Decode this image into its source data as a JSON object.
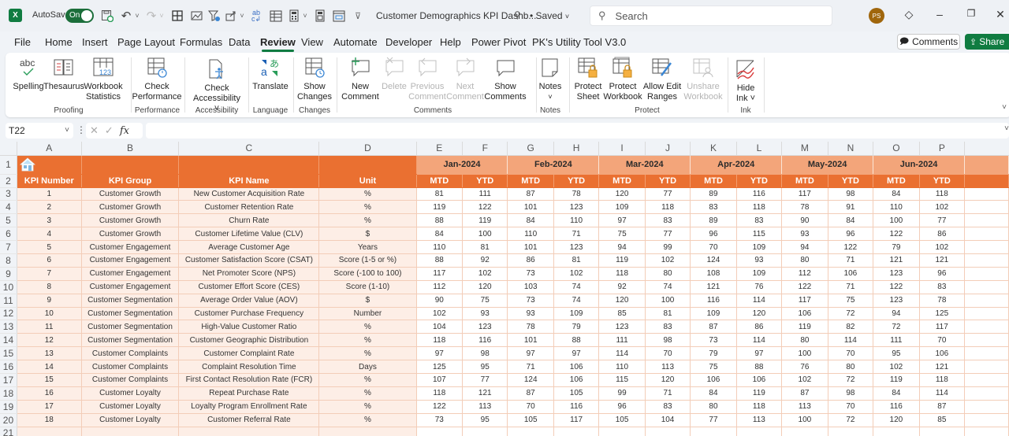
{
  "app": {
    "autosave_label": "AutoSave",
    "autosave_state": "On",
    "doc_title": "Customer Demographics KPI Dashb...",
    "saved_label": "• Saved",
    "search_placeholder": "Search",
    "user_initials": "PS",
    "brand_color": "#107c41"
  },
  "menu": {
    "tabs": [
      "File",
      "Home",
      "Insert",
      "Page Layout",
      "Formulas",
      "Data",
      "Review",
      "View",
      "Automate",
      "Developer",
      "Help",
      "Power Pivot",
      "PK's Utility Tool V3.0"
    ],
    "active": "Review",
    "comments_label": "Comments",
    "share_label": "Share"
  },
  "ribbon": {
    "buttons": {
      "spelling": "Spelling",
      "thesaurus": "Thesaurus",
      "workbook_statistics": [
        "Workbook",
        "Statistics"
      ],
      "check_performance": [
        "Check",
        "Performance"
      ],
      "check_accessibility": [
        "Check",
        "Accessibility ˅"
      ],
      "translate": "Translate",
      "show_changes": [
        "Show",
        "Changes"
      ],
      "new_comment": [
        "New",
        "Comment"
      ],
      "delete": "Delete",
      "previous_comment": [
        "Previous",
        "Comment"
      ],
      "next_comment": [
        "Next",
        "Comment"
      ],
      "show_comments": [
        "Show",
        "Comments"
      ],
      "notes": [
        "Notes",
        "˅"
      ],
      "protect_sheet": [
        "Protect",
        "Sheet"
      ],
      "protect_workbook": [
        "Protect",
        "Workbook"
      ],
      "allow_edit_ranges": [
        "Allow Edit",
        "Ranges"
      ],
      "unshare_workbook": [
        "Unshare",
        "Workbook"
      ],
      "hide_ink": [
        "Hide",
        "Ink ˅"
      ]
    },
    "groups": {
      "proofing": "Proofing",
      "performance": "Performance",
      "accessibility": "Accessibility",
      "language": "Language",
      "changes": "Changes",
      "comments": "Comments",
      "notes": "Notes",
      "protect": "Protect",
      "ink": "Ink"
    }
  },
  "formula_bar": {
    "name_box": "T22",
    "fx_label": "fx",
    "formula": ""
  },
  "sheet": {
    "column_letters": [
      "A",
      "B",
      "C",
      "D",
      "E",
      "F",
      "G",
      "H",
      "I",
      "J",
      "K",
      "L",
      "M",
      "N",
      "O",
      "P"
    ],
    "row_numbers": [
      "1",
      "2",
      "3",
      "4",
      "5",
      "6",
      "7",
      "8",
      "9",
      "10",
      "11",
      "12",
      "13",
      "14",
      "15",
      "16",
      "17",
      "18",
      "19",
      "20",
      "21"
    ],
    "headers": [
      "KPI Number",
      "KPI Group",
      "KPI Name",
      "Unit"
    ],
    "months": [
      "Jan-2024",
      "Feb-2024",
      "Mar-2024",
      "Apr-2024",
      "May-2024",
      "Jun-2024"
    ],
    "subheaders": [
      "MTD",
      "YTD"
    ],
    "header_color": "#ea7031",
    "month_color": "#f3a57a",
    "rows": [
      {
        "num": "1",
        "group": "Customer Growth",
        "name": "New Customer Acquisition Rate",
        "unit": "%",
        "values": [
          81,
          111,
          87,
          78,
          120,
          77,
          89,
          116,
          117,
          98,
          84,
          118
        ]
      },
      {
        "num": "2",
        "group": "Customer Growth",
        "name": "Customer Retention Rate",
        "unit": "%",
        "values": [
          119,
          122,
          101,
          123,
          109,
          118,
          83,
          118,
          78,
          91,
          110,
          102
        ]
      },
      {
        "num": "3",
        "group": "Customer Growth",
        "name": "Churn Rate",
        "unit": "%",
        "values": [
          88,
          119,
          84,
          110,
          97,
          83,
          89,
          83,
          90,
          84,
          100,
          77
        ]
      },
      {
        "num": "4",
        "group": "Customer Growth",
        "name": "Customer Lifetime Value (CLV)",
        "unit": "$",
        "values": [
          84,
          100,
          110,
          71,
          75,
          77,
          96,
          115,
          93,
          96,
          122,
          86
        ]
      },
      {
        "num": "5",
        "group": "Customer Engagement",
        "name": "Average Customer Age",
        "unit": "Years",
        "values": [
          110,
          81,
          101,
          123,
          94,
          99,
          70,
          109,
          94,
          122,
          79,
          102
        ]
      },
      {
        "num": "6",
        "group": "Customer Engagement",
        "name": "Customer Satisfaction Score (CSAT)",
        "unit": "Score (1-5 or %)",
        "values": [
          88,
          92,
          86,
          81,
          119,
          102,
          124,
          93,
          80,
          71,
          121,
          121
        ]
      },
      {
        "num": "7",
        "group": "Customer Engagement",
        "name": "Net Promoter Score (NPS)",
        "unit": "Score (-100 to 100)",
        "values": [
          117,
          102,
          73,
          102,
          118,
          80,
          108,
          109,
          112,
          106,
          123,
          96
        ]
      },
      {
        "num": "8",
        "group": "Customer Engagement",
        "name": "Customer Effort Score (CES)",
        "unit": "Score (1-10)",
        "values": [
          112,
          120,
          103,
          74,
          92,
          74,
          121,
          76,
          122,
          71,
          122,
          83
        ]
      },
      {
        "num": "9",
        "group": "Customer Segmentation",
        "name": "Average Order Value (AOV)",
        "unit": "$",
        "values": [
          90,
          75,
          73,
          74,
          120,
          100,
          116,
          114,
          117,
          75,
          123,
          78
        ]
      },
      {
        "num": "10",
        "group": "Customer Segmentation",
        "name": "Customer Purchase Frequency",
        "unit": "Number",
        "values": [
          102,
          93,
          93,
          109,
          85,
          81,
          109,
          120,
          106,
          72,
          94,
          125
        ]
      },
      {
        "num": "11",
        "group": "Customer Segmentation",
        "name": "High-Value Customer Ratio",
        "unit": "%",
        "values": [
          104,
          123,
          78,
          79,
          123,
          83,
          87,
          86,
          119,
          82,
          72,
          117
        ]
      },
      {
        "num": "12",
        "group": "Customer Segmentation",
        "name": "Customer Geographic Distribution",
        "unit": "%",
        "values": [
          118,
          116,
          101,
          88,
          111,
          98,
          73,
          114,
          80,
          114,
          111,
          70
        ]
      },
      {
        "num": "13",
        "group": "Customer Complaints",
        "name": "Customer Complaint Rate",
        "unit": "%",
        "values": [
          97,
          98,
          97,
          97,
          114,
          70,
          79,
          97,
          100,
          70,
          95,
          106
        ]
      },
      {
        "num": "14",
        "group": "Customer Complaints",
        "name": "Complaint Resolution Time",
        "unit": "Days",
        "values": [
          125,
          95,
          71,
          106,
          110,
          113,
          75,
          88,
          76,
          80,
          102,
          121
        ]
      },
      {
        "num": "15",
        "group": "Customer Complaints",
        "name": "First Contact Resolution Rate (FCR)",
        "unit": "%",
        "values": [
          107,
          77,
          124,
          106,
          115,
          120,
          106,
          106,
          102,
          72,
          119,
          118
        ]
      },
      {
        "num": "16",
        "group": "Customer Loyalty",
        "name": "Repeat Purchase Rate",
        "unit": "%",
        "values": [
          118,
          121,
          87,
          105,
          99,
          71,
          84,
          119,
          87,
          98,
          84,
          114
        ]
      },
      {
        "num": "17",
        "group": "Customer Loyalty",
        "name": "Loyalty Program Enrollment Rate",
        "unit": "%",
        "values": [
          122,
          113,
          70,
          116,
          96,
          83,
          80,
          118,
          113,
          70,
          116,
          87
        ]
      },
      {
        "num": "18",
        "group": "Customer Loyalty",
        "name": "Customer Referral Rate",
        "unit": "%",
        "values": [
          73,
          95,
          105,
          117,
          105,
          104,
          77,
          113,
          100,
          72,
          120,
          85
        ]
      }
    ]
  }
}
